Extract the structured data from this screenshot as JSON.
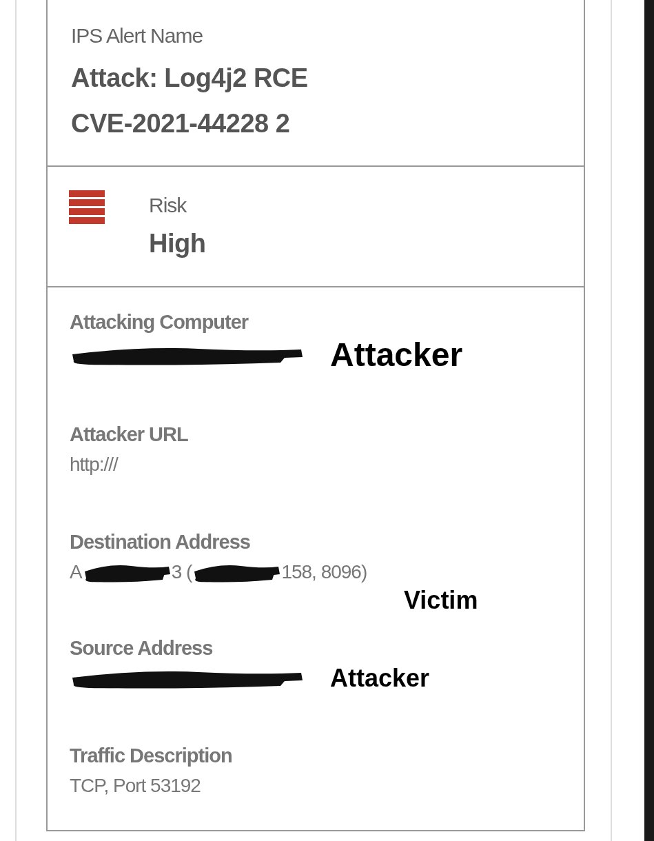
{
  "alert_name": {
    "label": "IPS Alert Name",
    "value_lines": [
      "Attack: Log4j2 RCE",
      "CVE-2021-44228 2"
    ]
  },
  "risk": {
    "label": "Risk",
    "value": "High",
    "color": "#c0392b"
  },
  "fields": [
    {
      "label": "Attacking Computer",
      "value": [
        {
          "kind": "redaction"
        }
      ],
      "annotation": "Attacker"
    },
    {
      "label": "Attacker URL",
      "value": [
        {
          "kind": "text",
          "text": "http:///"
        }
      ]
    },
    {
      "label": "Destination Address",
      "value": [
        {
          "kind": "text",
          "text": "A"
        },
        {
          "kind": "redaction"
        },
        {
          "kind": "text",
          "text": "3 ("
        },
        {
          "kind": "redaction"
        },
        {
          "kind": "text",
          "text": "158, 8096)"
        }
      ],
      "annotation": "Victim"
    },
    {
      "label": "Source Address",
      "value": [
        {
          "kind": "redaction"
        }
      ],
      "annotation": "Attacker"
    },
    {
      "label": "Traffic Description",
      "value": [
        {
          "kind": "text",
          "text": "TCP, Port 53192"
        }
      ]
    }
  ]
}
